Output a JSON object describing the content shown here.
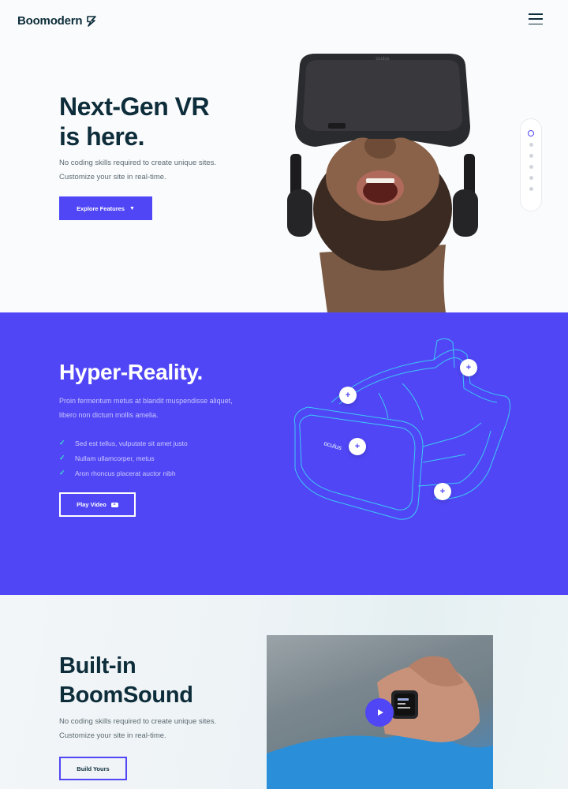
{
  "header": {
    "brand": "Boomodern",
    "menu_icon": "hamburger-icon"
  },
  "hero": {
    "title_line1": "Next-Gen VR",
    "title_line2": "is here.",
    "desc_line1": "No coding skills required to create unique sites.",
    "desc_line2": "Customize your site in real-time.",
    "cta_label": "Explore Features",
    "cta_icon": "caret-down-icon",
    "nav_dots": 6,
    "active_dot": 1
  },
  "hyper": {
    "title": "Hyper-Reality.",
    "desc_line1": "Proin fermentum metus at blandit muspendisse aliquet,",
    "desc_line2": "libero non dictum mollis amelia.",
    "features": [
      "Sed est tellus, vulputate sit amet justo",
      "Nullam ullamcorper, metus",
      "Aron rhoncus placerat auctor nibh"
    ],
    "cta_label": "Play Video",
    "cta_icon": "youtube-icon",
    "headset_brand": "oculus",
    "hotspot_symbol": "+"
  },
  "boom": {
    "title_line1": "Built-in",
    "title_line2": "BoomSound",
    "desc_line1": "No coding skills required to create unique sites.",
    "desc_line2": "Customize your site in real-time.",
    "cta_label": "Build Yours",
    "play_icon": "play-icon"
  },
  "colors": {
    "accent": "#5046f5",
    "dark": "#0d2d3a",
    "check": "#3de0c9"
  }
}
